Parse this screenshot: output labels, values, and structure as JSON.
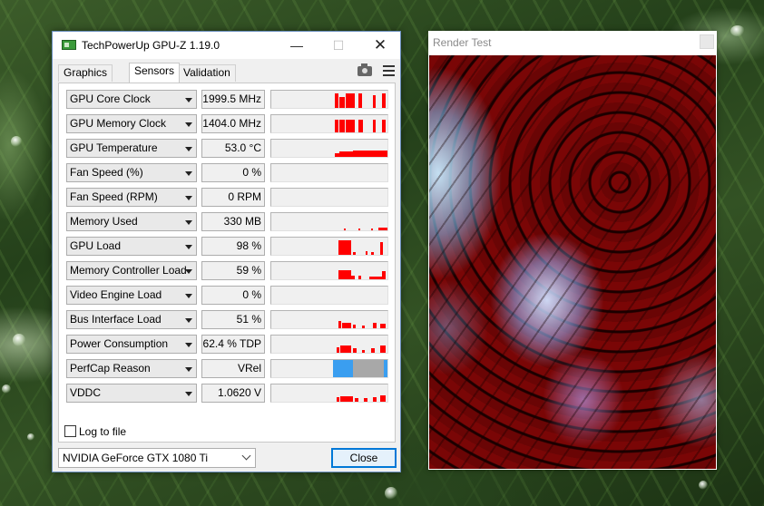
{
  "gpuz": {
    "title": "TechPowerUp GPU-Z 1.19.0",
    "window_controls": {
      "minimize": "—",
      "maximize": "☐",
      "close": "✕"
    },
    "tabs": [
      {
        "label": "Graphics Card",
        "active": false
      },
      {
        "label": "Sensors",
        "active": true
      },
      {
        "label": "Validation",
        "active": false
      }
    ],
    "icons": {
      "screenshot": "camera-icon",
      "menu": "hamburger-menu-icon"
    },
    "sensors": [
      {
        "name": "GPU Core Clock",
        "value": "1999.5 MHz",
        "graph": "red",
        "pattern": "core"
      },
      {
        "name": "GPU Memory Clock",
        "value": "1404.0 MHz",
        "graph": "red",
        "pattern": "mem"
      },
      {
        "name": "GPU Temperature",
        "value": "53.0 °C",
        "graph": "red",
        "pattern": "temp"
      },
      {
        "name": "Fan Speed (%)",
        "value": "0 %",
        "graph": "none",
        "pattern": "none"
      },
      {
        "name": "Fan Speed (RPM)",
        "value": "0 RPM",
        "graph": "none",
        "pattern": "none"
      },
      {
        "name": "Memory Used",
        "value": "330 MB",
        "graph": "red",
        "pattern": "memused"
      },
      {
        "name": "GPU Load",
        "value": "98 %",
        "graph": "red",
        "pattern": "load"
      },
      {
        "name": "Memory Controller Load",
        "value": "59 %",
        "graph": "red",
        "pattern": "mcl"
      },
      {
        "name": "Video Engine Load",
        "value": "0 %",
        "graph": "none",
        "pattern": "none"
      },
      {
        "name": "Bus Interface Load",
        "value": "51 %",
        "graph": "red",
        "pattern": "bus"
      },
      {
        "name": "Power Consumption",
        "value": "62.4 % TDP",
        "graph": "red",
        "pattern": "power"
      },
      {
        "name": "PerfCap Reason",
        "value": "VRel",
        "graph": "perfcap",
        "pattern": "perfcap"
      },
      {
        "name": "VDDC",
        "value": "1.0620 V",
        "graph": "red",
        "pattern": "vddc"
      }
    ],
    "log_to_file": {
      "label": "Log to file",
      "checked": false
    },
    "gpu_select": "NVIDIA GeForce GTX 1080 Ti",
    "close_button": "Close",
    "colors": {
      "graph_red": "#ff0000",
      "perfcap_blue": "#3a9ef0",
      "perfcap_grey": "#a8a8a8"
    }
  },
  "render_test": {
    "title": "Render Test"
  }
}
